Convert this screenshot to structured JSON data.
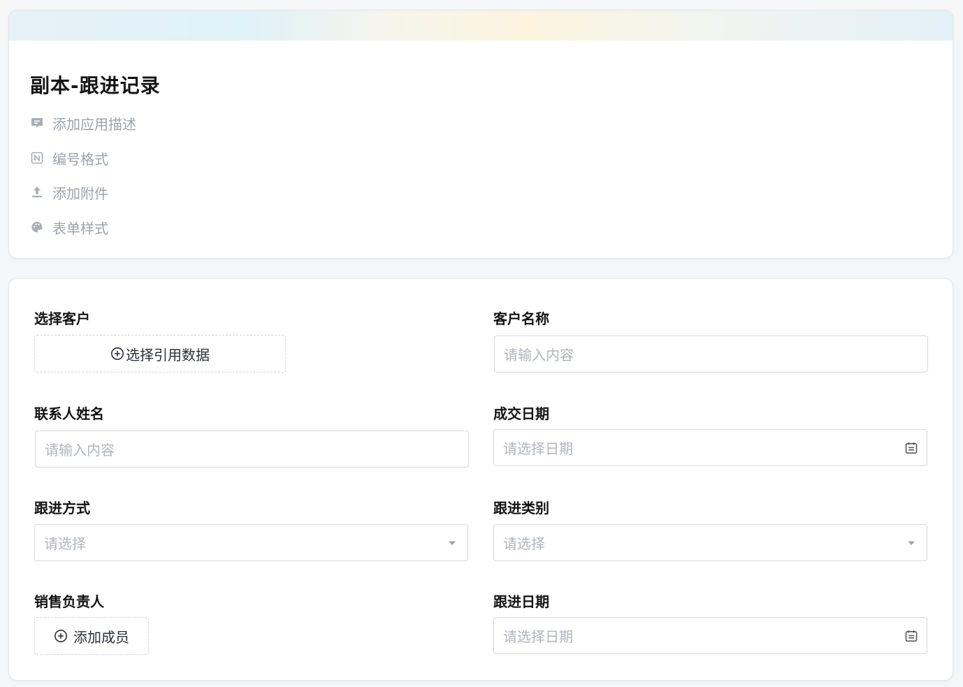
{
  "app": {
    "title": "副本-跟进记录",
    "meta_items": [
      {
        "label": "添加应用描述",
        "icon": "comment-icon"
      },
      {
        "label": "编号格式",
        "icon": "number-format-icon"
      },
      {
        "label": "添加附件",
        "icon": "upload-icon"
      },
      {
        "label": "表单样式",
        "icon": "palette-icon"
      }
    ]
  },
  "form": {
    "fields": {
      "select_customer": {
        "label": "选择客户",
        "button_label": "选择引用数据"
      },
      "customer_name": {
        "label": "客户名称",
        "placeholder": "请输入内容"
      },
      "contact_name": {
        "label": "联系人姓名",
        "placeholder": "请输入内容"
      },
      "deal_date": {
        "label": "成交日期",
        "placeholder": "请选择日期"
      },
      "followup_method": {
        "label": "跟进方式",
        "placeholder": "请选择"
      },
      "followup_category": {
        "label": "跟进类别",
        "placeholder": "请选择"
      },
      "sales_owner": {
        "label": "销售负责人",
        "button_label": "添加成员"
      },
      "followup_date": {
        "label": "跟进日期",
        "placeholder": "请选择日期"
      }
    }
  },
  "colors": {
    "muted_text": "#9da3ac",
    "placeholder": "#b1b5bc",
    "border": "#d6d9de"
  }
}
